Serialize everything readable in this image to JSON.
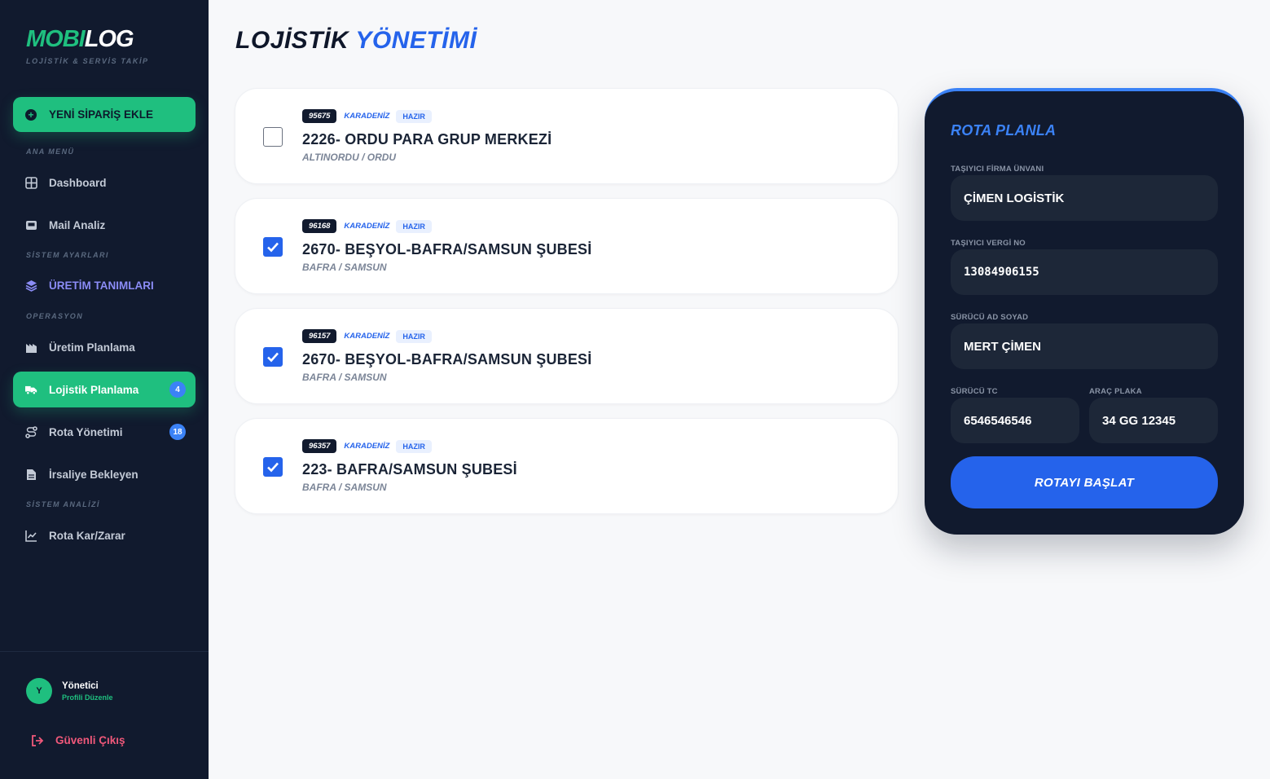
{
  "brand": {
    "name_part1": "MOBI",
    "name_part2": "LOG",
    "tagline": "LOJİSTİK & SERVİS TAKİP"
  },
  "sidebar": {
    "new_order_label": "YENİ SİPARİŞ EKLE",
    "sections": {
      "main": "ANA MENÜ",
      "settings": "SİSTEM AYARLARI",
      "operations": "OPERASYON",
      "analysis": "SİSTEM ANALİZİ"
    },
    "items": [
      {
        "label": "Dashboard",
        "icon": "grid-icon"
      },
      {
        "label": "Mail Analiz",
        "icon": "mail-box-icon"
      },
      {
        "label": "ÜRETİM TANIMLARI",
        "icon": "layers-icon"
      },
      {
        "label": "Üretim Planlama",
        "icon": "factory-icon"
      },
      {
        "label": "Lojistik Planlama",
        "icon": "truck-icon",
        "badge": "4",
        "active": true
      },
      {
        "label": "Rota Yönetimi",
        "icon": "route-icon",
        "badge": "18"
      },
      {
        "label": "İrsaliye Bekleyen",
        "icon": "document-icon"
      },
      {
        "label": "Rota Kar/Zarar",
        "icon": "chart-line-icon"
      }
    ],
    "profile": {
      "initial": "Y",
      "name": "Yönetici",
      "link": "Profili Düzenle"
    },
    "logout_label": "Güvenli Çıkış"
  },
  "page": {
    "title_part1": "LOJİSTİK ",
    "title_part2": "YÖNETİMİ"
  },
  "orders": [
    {
      "id": "95675",
      "region": "KARADENİZ",
      "status": "HAZIR",
      "title": "2226- ORDU PARA GRUP MERKEZİ",
      "location": "ALTINORDU / ORDU",
      "checked": false
    },
    {
      "id": "96168",
      "region": "KARADENİZ",
      "status": "HAZIR",
      "title": "2670- BEŞYOL-BAFRA/SAMSUN ŞUBESİ",
      "location": "BAFRA / SAMSUN",
      "checked": true
    },
    {
      "id": "96157",
      "region": "KARADENİZ",
      "status": "HAZIR",
      "title": "2670- BEŞYOL-BAFRA/SAMSUN ŞUBESİ",
      "location": "BAFRA / SAMSUN",
      "checked": true
    },
    {
      "id": "96357",
      "region": "KARADENİZ",
      "status": "HAZIR",
      "title": "223- BAFRA/SAMSUN ŞUBESİ",
      "location": "BAFRA / SAMSUN",
      "checked": true
    }
  ],
  "route_panel": {
    "title": "ROTA PLANLA",
    "carrier_label": "TAŞIYICI FİRMA ÜNVANI",
    "carrier_value": "ÇİMEN LOGİSTİK",
    "tax_label": "TAŞIYICI VERGİ NO",
    "tax_value": "13084906155",
    "driver_label": "SÜRÜCÜ AD SOYAD",
    "driver_value": "MERT ÇİMEN",
    "driver_tc_label": "SÜRÜCÜ TC",
    "driver_tc_value": "6546546546",
    "plate_label": "ARAÇ PLAKA",
    "plate_value": "34 GG 12345",
    "start_button": "ROTAYI BAŞLAT"
  },
  "colors": {
    "sidebar_bg": "#111a2e",
    "accent_green": "#1fbf7f",
    "accent_blue": "#2563eb",
    "badge_blue": "#3b82f6",
    "danger": "#f0587a"
  }
}
